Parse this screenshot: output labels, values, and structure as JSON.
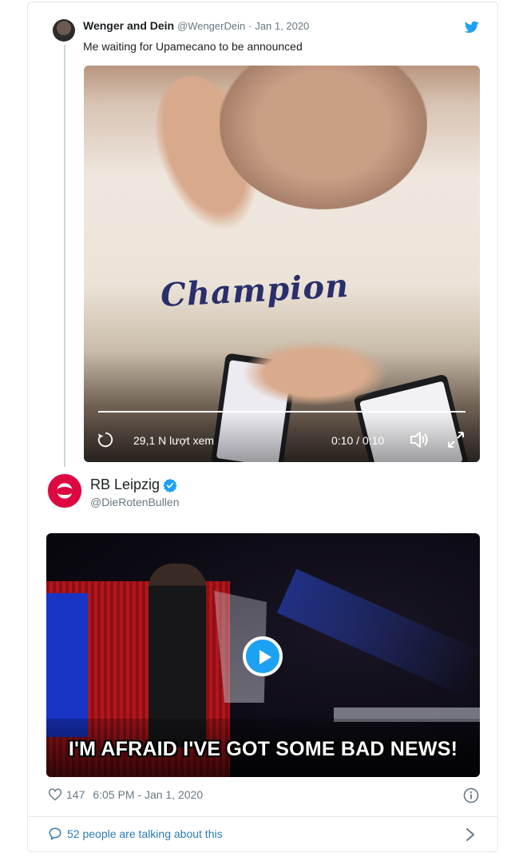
{
  "quoted_tweet": {
    "author_name": "Wenger and Dein",
    "author_handle": "@WengerDein",
    "separator": "·",
    "date": "Jan 1, 2020",
    "text": "Me waiting for Upamecano to be announced",
    "video": {
      "sweater_text": "Champion",
      "views": "29,1 N lượt xem",
      "time": "0:10 / 0:10",
      "progress_fraction": 1.0
    }
  },
  "main_tweet": {
    "author_name": "RB Leipzig",
    "author_handle": "@DieRotenBullen",
    "verified": true,
    "video_caption": "I'M AFRAID I'VE GOT SOME BAD NEWS!",
    "likes": "147",
    "timestamp": "6:05 PM - Jan 1, 2020",
    "talking": "52 people are talking about this"
  },
  "colors": {
    "twitter_blue": "#1da1f2",
    "link_blue": "#2b7bb9",
    "meta_gray": "#697882",
    "rb_red": "#dd0741"
  },
  "icons": [
    "twitter-bird-icon",
    "replay-icon",
    "volume-icon",
    "fullscreen-icon",
    "verified-badge-icon",
    "play-icon",
    "heart-icon",
    "info-icon",
    "comment-bubble-icon",
    "chevron-right-icon"
  ]
}
